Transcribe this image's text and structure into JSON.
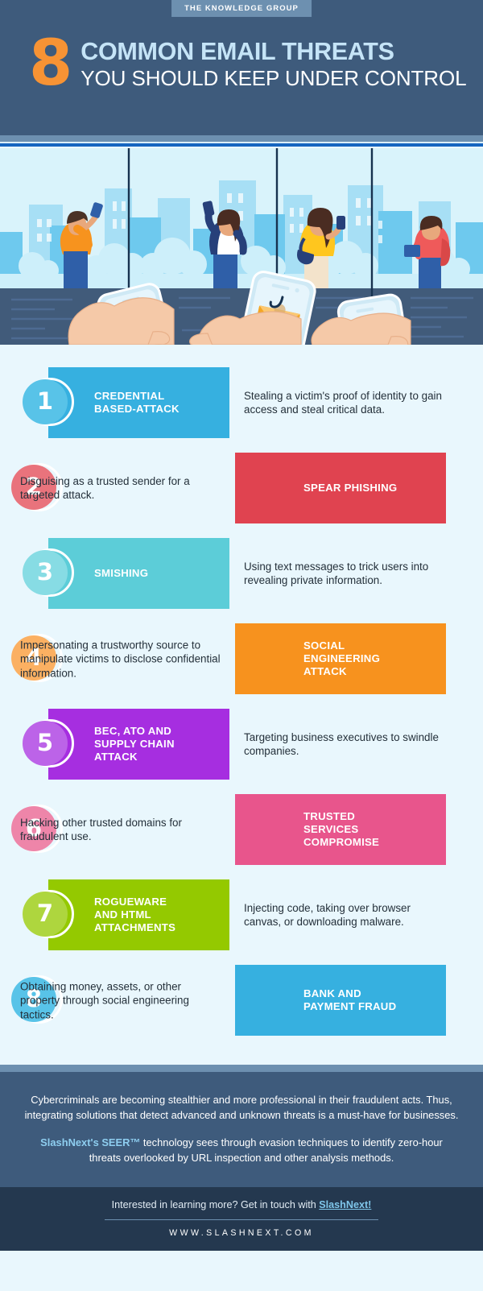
{
  "header": {
    "badge": "THE KNOWLEDGE GROUP",
    "number": "8",
    "title_line1": "COMMON EMAIL THREATS",
    "title_line2": "YOU SHOULD KEEP UNDER CONTROL",
    "bg_color": "#3e5b7c",
    "number_color": "#f79334",
    "title_line1_color": "#c5e4f7"
  },
  "illustration": {
    "alt": "People in a city using smartphones while hands below hold phones showing phishing emails on hooks",
    "sky_color": "#d9f3fb",
    "ground_color": "#415b7a"
  },
  "items": [
    {
      "number": "1",
      "label": "CREDENTIAL\nBASED-ATTACK",
      "description": "Stealing a victim's proof of identity to gain access and steal critical data.",
      "side": "left",
      "plate_color": "#36b0e0",
      "circle_color": "#58c3e8"
    },
    {
      "number": "2",
      "label": "SPEAR PHISHING",
      "description": "Disguising as a trusted sender for a targeted attack.",
      "side": "right",
      "plate_color": "#e04350",
      "circle_color": "#e9737c"
    },
    {
      "number": "3",
      "label": "SMISHING",
      "description": "Using text messages to trick users into revealing private information.",
      "side": "left",
      "plate_color": "#5ccdd8",
      "circle_color": "#87dce4"
    },
    {
      "number": "4",
      "label": "SOCIAL\nENGINEERING\nATTACK",
      "description": "Impersonating a trustworthy source to manipulate victims to disclose confidential information.",
      "side": "right",
      "plate_color": "#f7921e",
      "circle_color": "#fbb062"
    },
    {
      "number": "5",
      "label": "BEC, ATO AND\nSUPPLY CHAIN\nATTACK",
      "description": "Targeting business executives to swindle companies.",
      "side": "left",
      "plate_color": "#a62ee0",
      "circle_color": "#bc63e8"
    },
    {
      "number": "6",
      "label": "TRUSTED\nSERVICES\nCOMPROMISE",
      "description": "Hacking other trusted domains for fraudulent use.",
      "side": "right",
      "plate_color": "#e8558c",
      "circle_color": "#ee85a9"
    },
    {
      "number": "7",
      "label": "ROGUEWARE\nAND HTML\nATTACHMENTS",
      "description": "Injecting code, taking over browser canvas, or downloading malware.",
      "side": "left",
      "plate_color": "#94c900",
      "circle_color": "#aed63e"
    },
    {
      "number": "8",
      "label": "BANK AND\nPAYMENT FRAUD",
      "description": "Obtaining money, assets, or other property through social engineering tactics.",
      "side": "right",
      "plate_color": "#36b0e0",
      "circle_color": "#58c3e8"
    }
  ],
  "footer": {
    "paragraph1": "Cybercriminals are becoming stealthier and more professional in their fraudulent acts. Thus, integrating solutions that detect advanced and unknown threats is a must-have for businesses.",
    "paragraph2_brand": "SlashNext's SEER™",
    "paragraph2_rest": " technology sees through evasion techniques to identify zero-hour threats overlooked by URL inspection and other analysis methods.",
    "cta_text": "Interested in learning more? Get in touch with ",
    "cta_link": "SlashNext!",
    "domain": "WWW.SLASHNEXT.COM",
    "bg_color": "#3e5b7c",
    "bottom_bg_color": "#24384f",
    "link_color": "#7fc6ea"
  }
}
